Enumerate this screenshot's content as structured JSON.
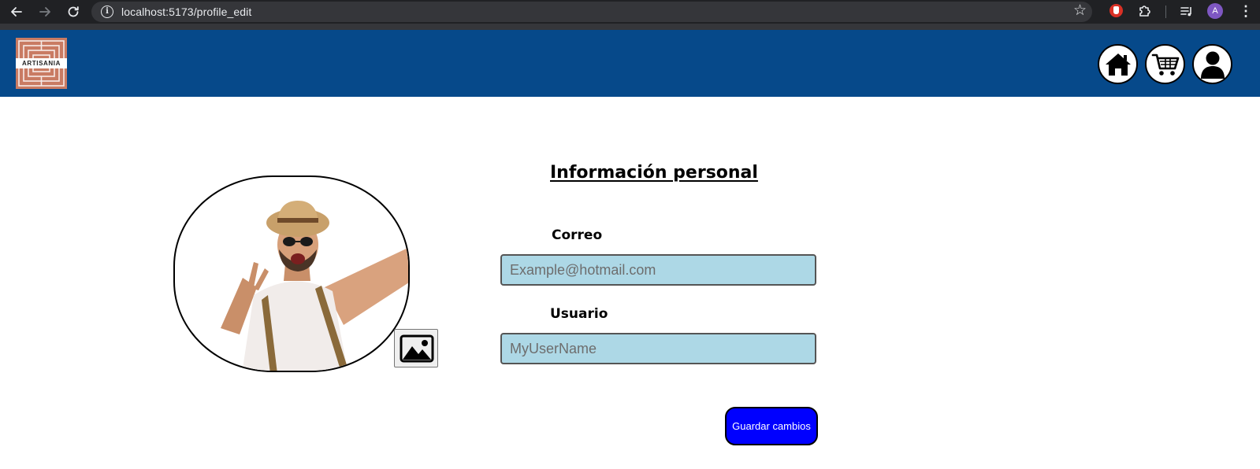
{
  "browser": {
    "url": "localhost:5173/profile_edit",
    "profile_initial": "A",
    "back_icon": "arrow-back-icon",
    "forward_icon": "arrow-forward-icon",
    "reload_icon": "reload-icon"
  },
  "header": {
    "logo_text": "ARTISANIA",
    "brand_color": "#06498a",
    "icons": [
      "home-icon",
      "cart-icon",
      "user-icon"
    ]
  },
  "profile": {
    "section_title": "Información personal",
    "email": {
      "label": "Correo",
      "placeholder": "Example@hotmail.com",
      "value": ""
    },
    "username": {
      "label": "Usuario",
      "placeholder": "MyUserName",
      "value": ""
    },
    "save_label": "Guardar cambios",
    "input_bg": "#add8e6",
    "save_bg": "#0000ff"
  }
}
